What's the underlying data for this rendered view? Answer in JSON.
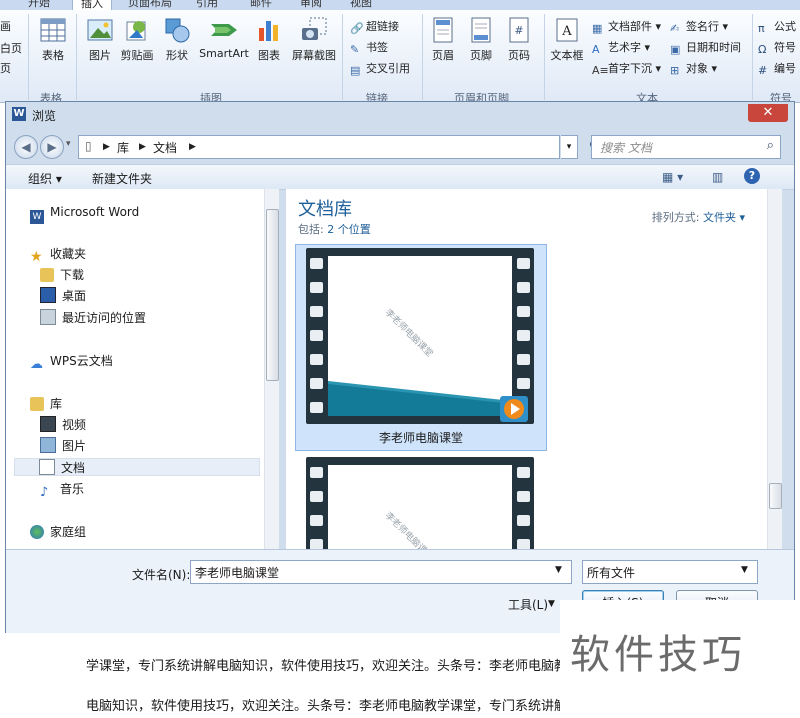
{
  "ribbon": {
    "tabs": [
      "开始",
      "插入",
      "页面布局",
      "引用",
      "邮件",
      "审阅",
      "视图"
    ],
    "left_partial": [
      "画",
      "白页",
      "页"
    ],
    "buttons": {
      "table": "表格",
      "picture": "图片",
      "clipart": "剪贴画",
      "shapes": "形状",
      "smartart": "SmartArt",
      "chart": "图表",
      "screenshot": "屏幕截图",
      "header": "页眉",
      "footer": "页脚",
      "page_number": "页码",
      "textbox": "文本框"
    },
    "small": {
      "hyperlink": "超链接",
      "bookmark": "书签",
      "crossref": "交叉引用",
      "quickparts": "文档部件",
      "wordart": "艺术字",
      "dropcap": "首字下沉",
      "signature": "签名行",
      "datetime": "日期和时间",
      "object": "对象",
      "equation": "公式",
      "symbol": "符号",
      "number": "编号"
    },
    "groups": {
      "tables": "表格",
      "illustrations": "插图",
      "links": "链接",
      "header_footer": "页眉和页脚",
      "text": "文本",
      "symbols": "符号"
    }
  },
  "dialog": {
    "title": "浏览",
    "address": [
      "库",
      "文档"
    ],
    "search_placeholder": "搜索 文档",
    "toolbar": {
      "organize": "组织 ▾",
      "new_folder": "新建文件夹"
    },
    "nav": {
      "microsoft_word": "Microsoft Word",
      "favorites": "收藏夹",
      "downloads": "下载",
      "desktop": "桌面",
      "recent": "最近访问的位置",
      "wps": "WPS云文档",
      "libraries": "库",
      "videos": "视频",
      "pictures": "图片",
      "documents": "文档",
      "music": "音乐",
      "homegroup": "家庭组"
    },
    "content": {
      "title": "文档库",
      "includes_label": "包括:",
      "includes_link": "2 个位置",
      "sort_label": "排列方式:",
      "sort_value": "文件夹 ▾",
      "items": [
        {
          "name": "李老师电脑课堂",
          "watermark": "李老师电脑课堂"
        },
        {
          "name": "",
          "watermark": "李老师电脑课堂"
        }
      ]
    },
    "bottom": {
      "filename_label": "文件名(N):",
      "filename_value": "李老师电脑课堂",
      "filetype_value": "所有文件",
      "tools": "工具(L)",
      "insert": "插入(S)",
      "cancel": "取消"
    }
  },
  "document": {
    "line1": "学课堂，专门系统讲解电脑知识，软件使用技巧，欢迎关注。头条号：李老师电脑教",
    "line2": "电脑知识，软件使用技巧，欢迎关注。头条号：李老师电脑教学课堂，专门系统讲解"
  },
  "watermark": "软件技巧"
}
